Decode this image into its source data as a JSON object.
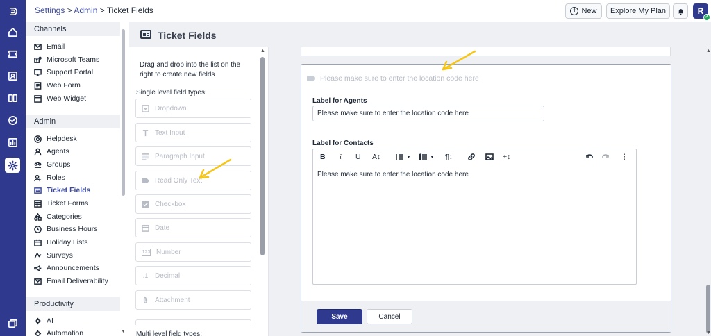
{
  "topbar": {
    "breadcrumb": {
      "settings": "Settings",
      "sep1": " > ",
      "admin": "Admin",
      "sep2": " > ",
      "current": "Ticket Fields"
    },
    "new_label": "New",
    "plan_label": "Explore My Plan",
    "avatar_initial": "R"
  },
  "sidebar": {
    "channels_header": "Channels",
    "channels": [
      {
        "label": "Email",
        "icon": "mail-icon"
      },
      {
        "label": "Microsoft Teams",
        "icon": "teams-icon"
      },
      {
        "label": "Support Portal",
        "icon": "portal-icon"
      },
      {
        "label": "Web Form",
        "icon": "form-icon"
      },
      {
        "label": "Web Widget",
        "icon": "widget-icon"
      }
    ],
    "admin_header": "Admin",
    "admin": [
      {
        "label": "Helpdesk",
        "icon": "helpdesk-icon"
      },
      {
        "label": "Agents",
        "icon": "agent-icon"
      },
      {
        "label": "Groups",
        "icon": "groups-icon"
      },
      {
        "label": "Roles",
        "icon": "roles-icon"
      },
      {
        "label": "Ticket Fields",
        "icon": "ticket-fields-icon"
      },
      {
        "label": "Ticket Forms",
        "icon": "ticket-forms-icon"
      },
      {
        "label": "Categories",
        "icon": "categories-icon"
      },
      {
        "label": "Business Hours",
        "icon": "clock-icon"
      },
      {
        "label": "Holiday Lists",
        "icon": "calendar-icon"
      },
      {
        "label": "Surveys",
        "icon": "survey-icon"
      },
      {
        "label": "Announcements",
        "icon": "megaphone-icon"
      },
      {
        "label": "Email Deliverability",
        "icon": "mail-icon"
      }
    ],
    "productivity_header": "Productivity",
    "productivity": [
      {
        "label": "AI",
        "icon": "ai-icon"
      },
      {
        "label": "Automation",
        "icon": "automation-icon"
      }
    ]
  },
  "page": {
    "title": "Ticket Fields"
  },
  "palette": {
    "description": "Drag and drop into the list on the right to create new fields",
    "single_header": "Single level field types:",
    "types": [
      {
        "label": "Dropdown",
        "icon": "dropdown-icon"
      },
      {
        "label": "Text Input",
        "icon": "text-icon"
      },
      {
        "label": "Paragraph Input",
        "icon": "paragraph-icon"
      },
      {
        "label": "Read Only Text",
        "icon": "tag-icon"
      },
      {
        "label": "Checkbox",
        "icon": "checkbox-icon"
      },
      {
        "label": "Date",
        "icon": "date-icon"
      },
      {
        "label": "Number",
        "icon": "number-icon",
        "glyph": "123"
      },
      {
        "label": "Decimal",
        "icon": "decimal-icon",
        "glyph": ".1"
      },
      {
        "label": "Attachment",
        "icon": "paperclip-icon"
      }
    ],
    "multi_header": "Multi level field types:"
  },
  "editor_card": {
    "preview_text": "Please make sure to enter the location code here",
    "agents_label": "Label for Agents",
    "agents_value": "Please make sure to enter the location code here",
    "contacts_label": "Label for Contacts",
    "contacts_value": "Please make sure to enter the location code here",
    "toolbar": {
      "bold": "B",
      "italic": "i",
      "underline": "U",
      "fontsize": "A↕",
      "paragraph": "¶↕",
      "insert": "+↕",
      "more": "⋮"
    },
    "save_label": "Save",
    "cancel_label": "Cancel"
  },
  "colors": {
    "brand": "#2f3a8f",
    "annotation": "#f5c518"
  }
}
